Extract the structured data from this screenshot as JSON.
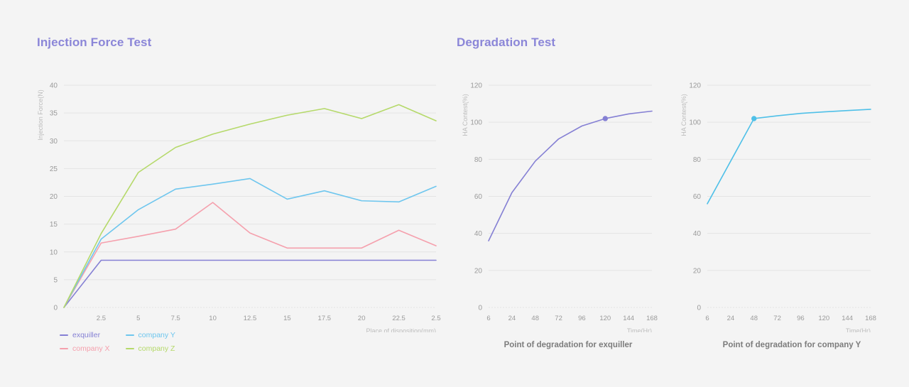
{
  "page": {
    "background": "#f4f4f4",
    "title_color": "#8b86d8"
  },
  "panels": {
    "left": {
      "title": "Injection Force Test"
    },
    "right": {
      "title": "Degradation Test"
    }
  },
  "legend": {
    "items": [
      {
        "label": "exquiller",
        "color": "#8580d4",
        "name": "legend-item-exquiller"
      },
      {
        "label": "company Y",
        "color": "#6ec6ee",
        "name": "legend-item-company-y"
      },
      {
        "label": "company X",
        "color": "#f5a0ad",
        "name": "legend-item-company-x"
      },
      {
        "label": "company Z",
        "color": "#b5d96a",
        "name": "legend-item-company-z"
      }
    ]
  },
  "captions": {
    "middle": "Point of degradation for exquiller",
    "right": "Point of degradation for company Y"
  },
  "chart_data": [
    {
      "id": "injection-force-test",
      "type": "line",
      "title": "Injection Force Test",
      "xlabel": "Place of disposition(mm)",
      "ylabel": "Injection Force(N)",
      "xlim": [
        0,
        25
      ],
      "ylim": [
        0,
        40
      ],
      "grid": true,
      "legend_position": "bottom-left",
      "xticks": [
        2.5,
        5,
        7.5,
        10,
        12.5,
        15,
        17.5,
        20,
        22.5,
        25
      ],
      "xticklabels": [
        "2.5",
        "5",
        "7.5",
        "10",
        "12.5",
        "15",
        "17.5",
        "20",
        "22.5",
        "2.5"
      ],
      "yticks": [
        0,
        5,
        10,
        15,
        20,
        25,
        30,
        35,
        40
      ],
      "yticklabels": [
        "0",
        "5",
        "10",
        "15",
        "20",
        "25",
        "30",
        "35",
        "40"
      ],
      "x": [
        0,
        2.5,
        5,
        7.5,
        10,
        12.5,
        15,
        17.5,
        20,
        22.5,
        25
      ],
      "series": [
        {
          "name": "exquiller",
          "color": "#8580d4",
          "values": [
            0,
            8.5,
            8.5,
            8.5,
            8.5,
            8.5,
            8.5,
            8.5,
            8.5,
            8.5,
            8.5
          ]
        },
        {
          "name": "company X",
          "color": "#f5a0ad",
          "values": [
            0,
            11.6,
            12.8,
            14.1,
            18.9,
            13.4,
            10.7,
            10.7,
            10.7,
            13.9,
            11.1
          ]
        },
        {
          "name": "company Y",
          "color": "#6ec6ee",
          "values": [
            0,
            12.3,
            17.6,
            21.3,
            22.2,
            23.2,
            19.5,
            21.0,
            19.2,
            19.0,
            21.8
          ]
        },
        {
          "name": "company Z",
          "color": "#b5d96a",
          "values": [
            0,
            13.3,
            24.3,
            28.8,
            31.2,
            33.0,
            34.6,
            35.8,
            34.0,
            36.5,
            33.6
          ]
        }
      ]
    },
    {
      "id": "degradation-exquiller",
      "type": "line",
      "title": "Point of degradation for exquiller",
      "xlabel": "Time(Hr)",
      "ylabel": "HA Contest(%)",
      "xlim": [
        0,
        7
      ],
      "ylim": [
        0,
        120
      ],
      "grid": true,
      "legend_position": "none",
      "xticks": [
        0,
        1,
        2,
        3,
        4,
        5,
        6,
        7
      ],
      "xticklabels": [
        "6",
        "24",
        "48",
        "72",
        "96",
        "120",
        "144",
        "168"
      ],
      "yticks": [
        0,
        20,
        40,
        60,
        80,
        100,
        120
      ],
      "yticklabels": [
        "0",
        "20",
        "40",
        "60",
        "80",
        "100",
        "120"
      ],
      "x": [
        0,
        1,
        2,
        3,
        4,
        5,
        6,
        7
      ],
      "series": [
        {
          "name": "exquiller",
          "color": "#8580d4",
          "values": [
            36,
            62,
            79,
            91,
            98,
            102,
            104.5,
            106
          ],
          "marker_index": 5,
          "marker_value": 102
        }
      ]
    },
    {
      "id": "degradation-company-y",
      "type": "line",
      "title": "Point of degradation for company Y",
      "xlabel": "Time(Hr)",
      "ylabel": "HA Contest(%)",
      "xlim": [
        0,
        7
      ],
      "ylim": [
        0,
        120
      ],
      "grid": true,
      "legend_position": "none",
      "xticks": [
        0,
        1,
        2,
        3,
        4,
        5,
        6,
        7
      ],
      "xticklabels": [
        "6",
        "24",
        "48",
        "72",
        "96",
        "120",
        "144",
        "168"
      ],
      "yticks": [
        0,
        20,
        40,
        60,
        80,
        100,
        120
      ],
      "yticklabels": [
        "0",
        "20",
        "40",
        "60",
        "80",
        "100",
        "120"
      ],
      "x": [
        0,
        1,
        2,
        3,
        4,
        5,
        6,
        7
      ],
      "series": [
        {
          "name": "company Y",
          "color": "#4fc0e8",
          "values": [
            56,
            79,
            102,
            103.5,
            104.8,
            105.6,
            106.3,
            107
          ],
          "marker_index": 2,
          "marker_value": 102
        }
      ]
    }
  ]
}
